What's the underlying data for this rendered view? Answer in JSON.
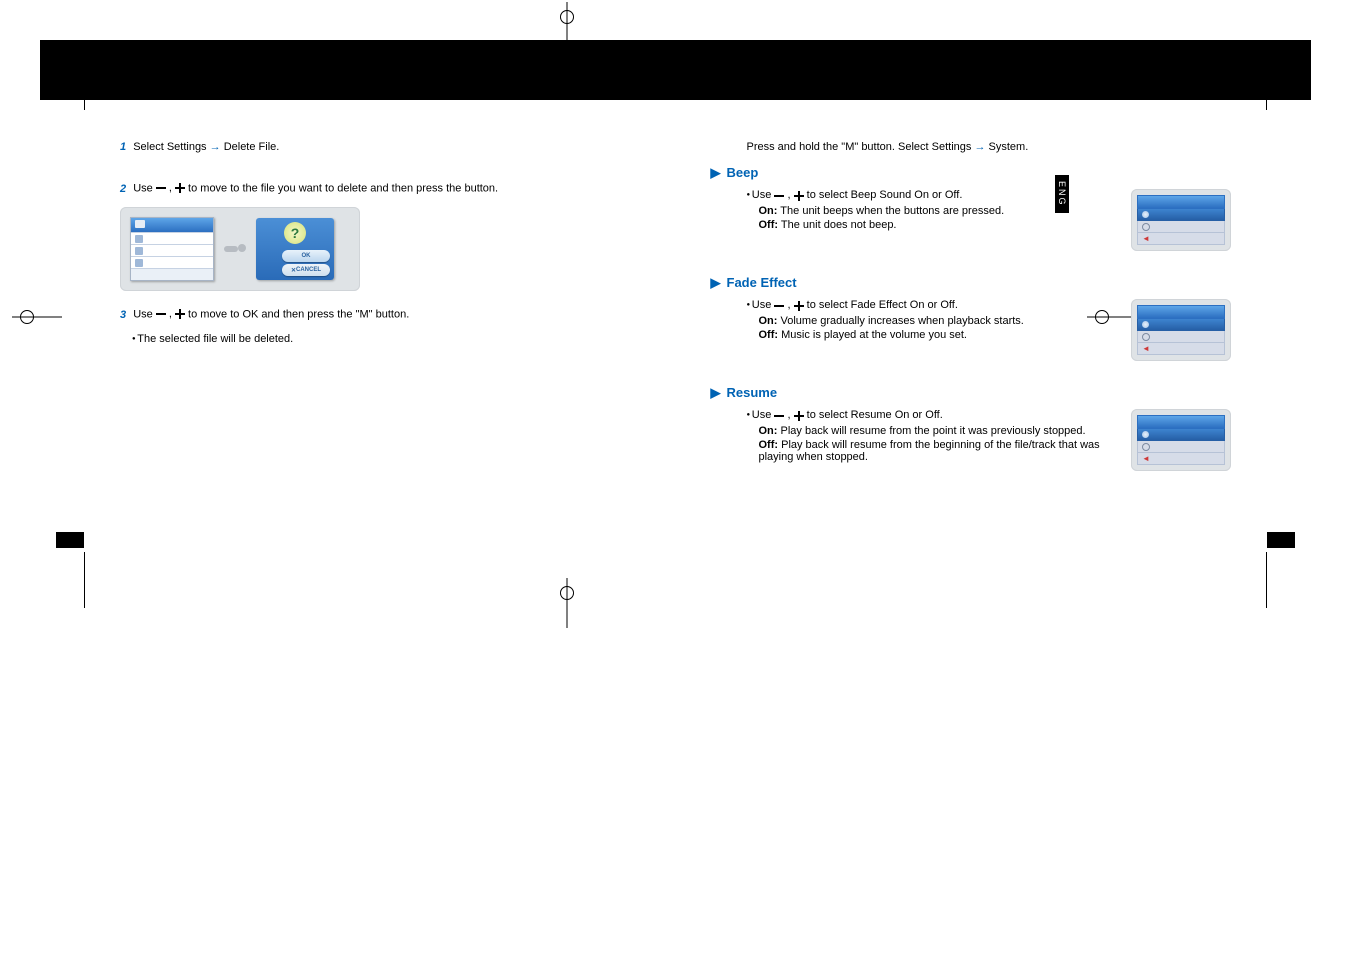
{
  "lang_tab": "ENG",
  "left": {
    "step1_num": "1",
    "step1_a": "Select Settings",
    "step1_b": "Delete File.",
    "step2_num": "2",
    "step2_a": "Use ",
    "step2_b": " to move to the file you want to delete and then press the ",
    "step2_c": " button.",
    "step3_num": "3",
    "step3_a": "Use ",
    "step3_b": " to move to OK and then press the \"M\" button.",
    "step3_note": "The selected file will be deleted.",
    "dialog_ok": "OK",
    "dialog_cancel": "CANCEL"
  },
  "right": {
    "intro_a": "Press and hold the \"M\" button. Select Settings",
    "intro_b": "System.",
    "sections": [
      {
        "heading": "Beep",
        "line_a": "Use ",
        "line_b": " to select Beep Sound On or Off.",
        "opt1_label": "On:",
        "opt1_text": " The unit beeps when the buttons are pressed.",
        "opt2_label": "Off:",
        "opt2_text": " The unit does not beep."
      },
      {
        "heading": "Fade Effect",
        "line_a": "Use ",
        "line_b": " to select Fade Effect On or Off.",
        "opt1_label": "On:",
        "opt1_text": " Volume gradually increases when playback starts.",
        "opt2_label": "Off:",
        "opt2_text": " Music is played at the volume you set."
      },
      {
        "heading": "Resume",
        "line_a": "Use ",
        "line_b": " to select Resume On or Off.",
        "opt1_label": "On:",
        "opt1_text": " Play back will resume from the point it was previously stopped.",
        "opt2_label": "Off:",
        "opt2_text": " Play back will resume from the beginning of the file/track that was playing when stopped."
      }
    ]
  }
}
